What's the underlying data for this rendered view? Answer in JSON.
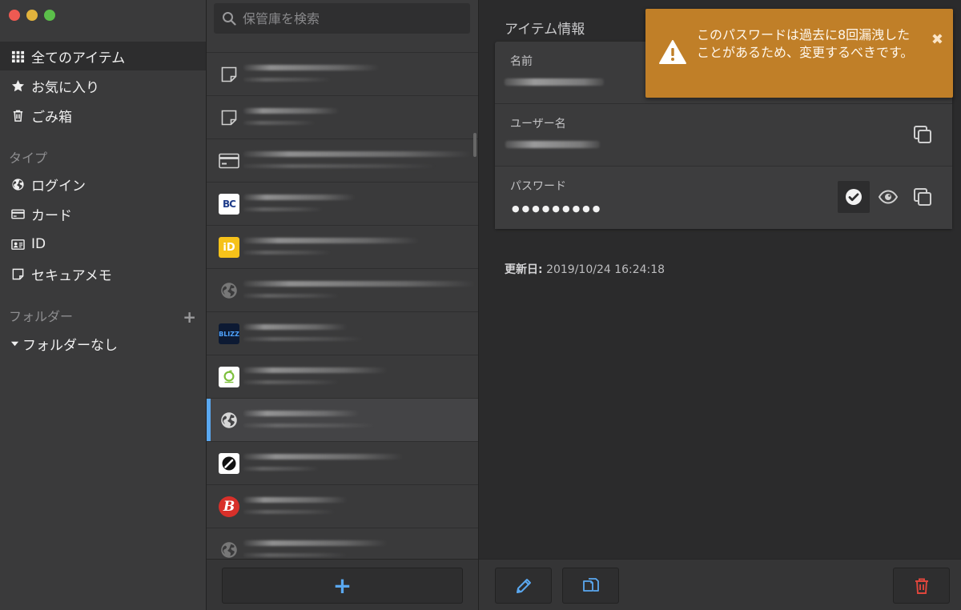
{
  "sidebar": {
    "items": [
      {
        "label": "全てのアイテム",
        "icon": "grid-icon",
        "active": true
      },
      {
        "label": "お気に入り",
        "icon": "star-icon"
      },
      {
        "label": "ごみ箱",
        "icon": "trash-icon"
      }
    ],
    "type_section": "タイプ",
    "types": [
      {
        "label": "ログイン",
        "icon": "globe-icon"
      },
      {
        "label": "カード",
        "icon": "credit-card-icon"
      },
      {
        "label": "ID",
        "icon": "id-card-icon"
      },
      {
        "label": "セキュアメモ",
        "icon": "note-icon"
      }
    ],
    "folder_section": "フォルダー",
    "add_folder": "+",
    "no_folder": "フォルダーなし"
  },
  "search": {
    "placeholder": "保管庫を検索"
  },
  "list": {
    "items": [
      {
        "icon": "note-icon"
      },
      {
        "icon": "note-icon"
      },
      {
        "icon": "credit-card-icon"
      },
      {
        "icon": "bc-logo-icon",
        "badge": "BC"
      },
      {
        "icon": "id-logo-icon",
        "badge": "iD"
      },
      {
        "icon": "globe-icon"
      },
      {
        "icon": "blizz-logo-icon",
        "badge": "BLIZZ"
      },
      {
        "icon": "green-logo-icon"
      },
      {
        "icon": "globe-icon",
        "selected": true
      },
      {
        "icon": "gauge-logo-icon"
      },
      {
        "icon": "b-logo-icon",
        "badge": "B"
      },
      {
        "icon": "globe-icon"
      }
    ],
    "add_label": "+"
  },
  "detail": {
    "title": "アイテム情報",
    "fields": {
      "name_label": "名前",
      "username_label": "ユーザー名",
      "password_label": "パスワード",
      "password_value": "●●●●●●●●●"
    },
    "updated_label": "更新日:",
    "updated_value": "2019/10/24 16:24:18"
  },
  "alert": {
    "message": "このパスワードは過去に8回漏洩したことがあるため、変更するべきです。",
    "close": "✖"
  },
  "colors": {
    "accent": "#5aa8f0",
    "alert_bg": "#c07f28",
    "delete": "#e0463c"
  }
}
